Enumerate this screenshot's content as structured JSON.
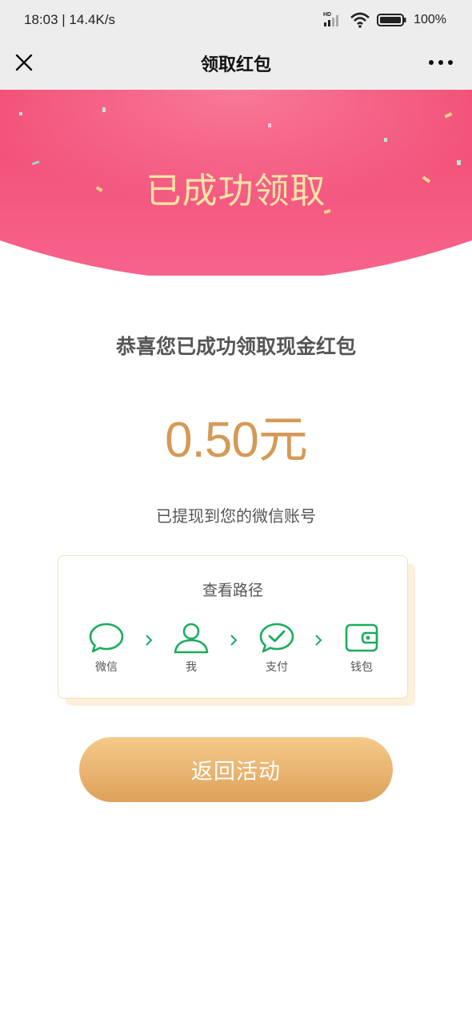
{
  "status_bar": {
    "time_speed": "18:03 | 14.4K/s",
    "network_badge": "HD",
    "battery_percent": "100%"
  },
  "nav": {
    "title": "领取红包",
    "close_icon": "close-icon",
    "more_icon": "more-icon"
  },
  "header": {
    "title": "已成功领取",
    "colors": {
      "top": "#f14a72",
      "bottom": "#f7648c",
      "title": "#fde4a5"
    }
  },
  "result": {
    "congrats": "恭喜您已成功领取现金红包",
    "amount": "0.50元",
    "note": "已提现到您的微信账号",
    "amount_color": "#d59a56"
  },
  "path_card": {
    "title": "查看路径",
    "steps": [
      {
        "label": "微信",
        "icon": "chat-bubble-icon"
      },
      {
        "label": "我",
        "icon": "person-icon"
      },
      {
        "label": "支付",
        "icon": "pay-check-icon"
      },
      {
        "label": "钱包",
        "icon": "wallet-icon"
      }
    ],
    "icon_color": "#1aad5b"
  },
  "action": {
    "return_label": "返回活动",
    "button_colors": {
      "top": "#f6c98a",
      "bottom": "#dda25a"
    }
  }
}
